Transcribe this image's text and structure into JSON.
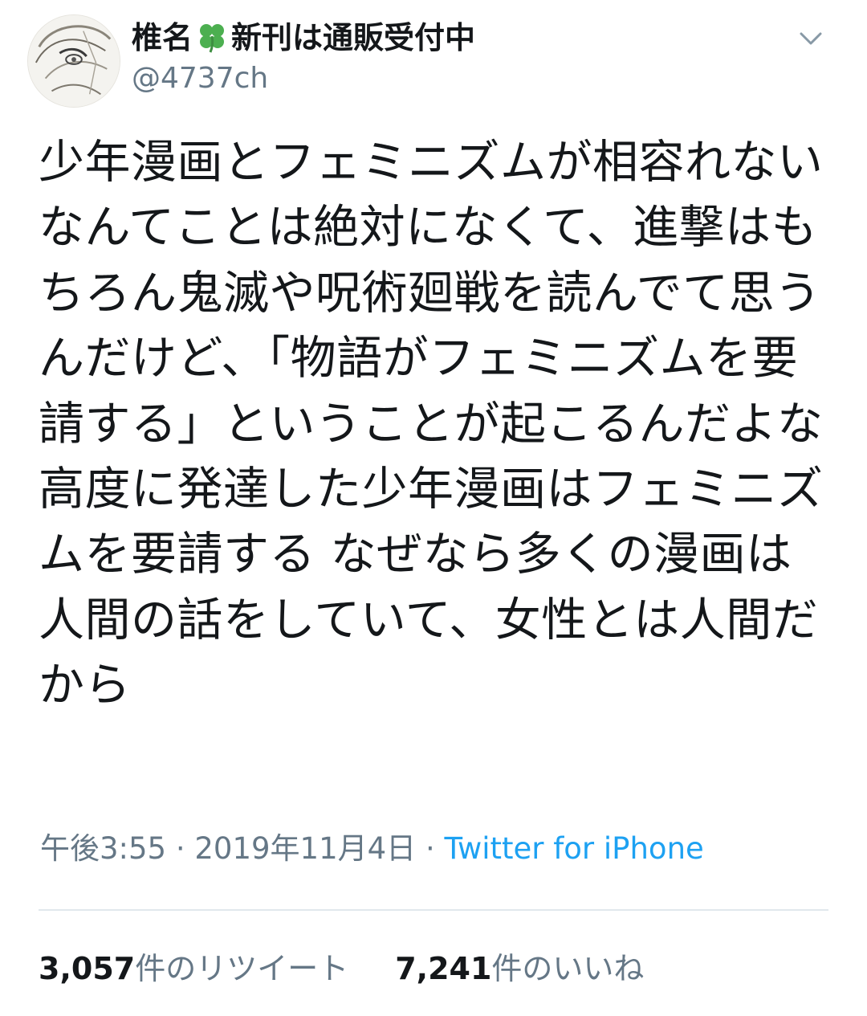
{
  "user": {
    "display_name_prefix": "椎名",
    "display_name_suffix": "新刊は通販受付中",
    "emoji": "four-leaf-clover-icon",
    "handle": "@4737ch"
  },
  "tweet": {
    "text": "少年漫画とフェミニズムが相容れないなんてことは絶対になくて、進撃はもちろん鬼滅や呪術廻戦を読んでて思うんだけど、「物語がフェミニズムを要請する」ということが起こるんだよな 高度に発達した少年漫画はフェミニズムを要請する なぜなら多くの漫画は人間の話をしていて、女性とは人間だから"
  },
  "meta": {
    "time": "午後3:55",
    "separator": "·",
    "date": "2019年11月4日",
    "source": "Twitter for iPhone"
  },
  "stats": {
    "retweets_count": "3,057",
    "retweets_label": "件のリツイート",
    "likes_count": "7,241",
    "likes_label": "件のいいね"
  },
  "colors": {
    "text": "#14171a",
    "secondary": "#657786",
    "link": "#1da1f2",
    "divider": "#e1e8ed",
    "clover": "#4caf50"
  }
}
